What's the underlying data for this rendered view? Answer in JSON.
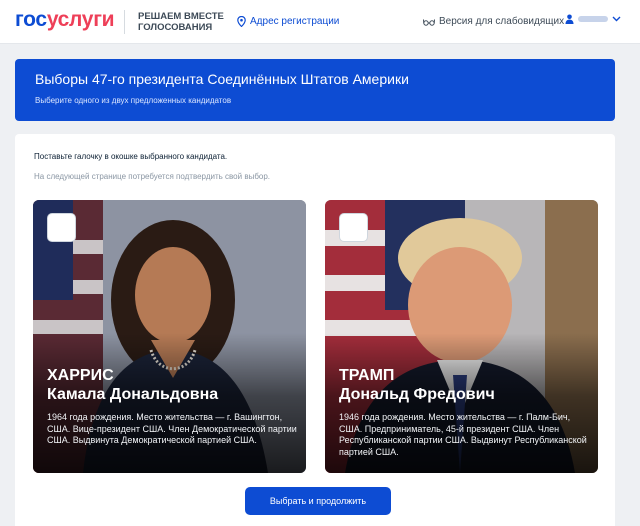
{
  "header": {
    "logo_part1": "гос",
    "logo_part2": "услуги",
    "slogan_line1": "РЕШАЕМ ВМЕСТЕ",
    "slogan_line2": "ГОЛОСОВАНИЯ",
    "address_link": "Адрес регистрации",
    "vision_link": "Версия для слабовидящих",
    "user_name": "· · ·"
  },
  "banner": {
    "title": "Выборы 47-го президента Соединённых Штатов Америки",
    "subtitle": "Выберите одного из двух предложенных кандидатов"
  },
  "main": {
    "instruction": "Поставьте галочку в окошке выбранного кандидата.",
    "hint": "На следующей странице потребуется подтвердить свой выбор."
  },
  "candidates": [
    {
      "surname": "ХАРРИС",
      "given_names": "Камала Дональдовна",
      "bio": "1964 года рождения. Место жительства — г. Вашингтон, США. Вице-президент США. Член Демократической партии США. Выдвинута Демократической партией США."
    },
    {
      "surname": "ТРАМП",
      "given_names": "Дональд Фредович",
      "bio": "1946 года рождения. Место жительства — г. Палм-Бич, США. Предприниматель, 45-й президент США. Член Республиканской партии США. Выдвинут Республиканской партией США."
    }
  ],
  "actions": {
    "continue_label": "Выбрать и продолжить"
  },
  "colors": {
    "brand_blue": "#0d4cd3",
    "brand_red": "#ee3f58"
  }
}
